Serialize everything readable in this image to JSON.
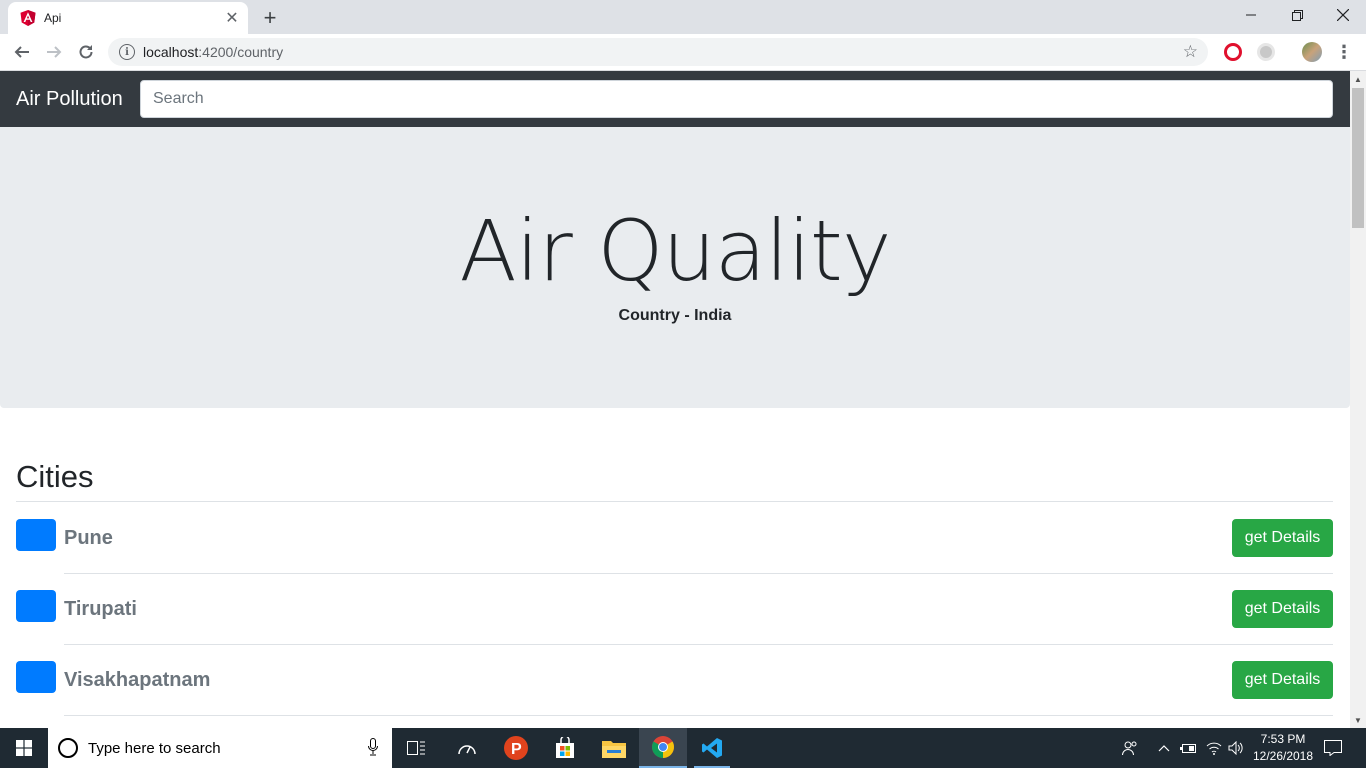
{
  "browser": {
    "tab_title": "Api",
    "url_host": "localhost",
    "url_path": ":4200/country"
  },
  "app": {
    "brand": "Air Pollution",
    "search_placeholder": "Search"
  },
  "jumbotron": {
    "title": "Air Quality",
    "subtitle": "Country - India"
  },
  "cities_section": {
    "title": "Cities",
    "button_label": "get Details",
    "items": [
      {
        "name": "Pune"
      },
      {
        "name": "Tirupati"
      },
      {
        "name": "Visakhapatnam"
      }
    ]
  },
  "taskbar": {
    "search_placeholder": "Type here to search",
    "time": "7:53 PM",
    "date": "12/26/2018"
  },
  "colors": {
    "navbar": "#343a40",
    "jumbotron": "#e9ecef",
    "city_thumb": "#007bff",
    "button": "#28a745"
  },
  "icons": {
    "tab_favicon": "angular-icon",
    "window_controls": [
      "minimize-icon",
      "restore-icon",
      "close-icon"
    ],
    "nav": [
      "back-arrow-icon",
      "forward-arrow-icon",
      "reload-icon"
    ],
    "omnibox": [
      "info-icon",
      "star-icon"
    ],
    "extensions": [
      "opera-icon",
      "extension-icon",
      "profile-avatar"
    ],
    "taskbar": [
      "windows-start-icon",
      "task-view-icon",
      "speedometer-icon",
      "psiphon-icon",
      "store-icon",
      "file-explorer-icon",
      "chrome-icon",
      "vscode-icon"
    ],
    "tray": [
      "people-icon",
      "chevron-up-icon",
      "battery-icon",
      "wifi-icon",
      "volume-icon",
      "notification-icon"
    ]
  }
}
